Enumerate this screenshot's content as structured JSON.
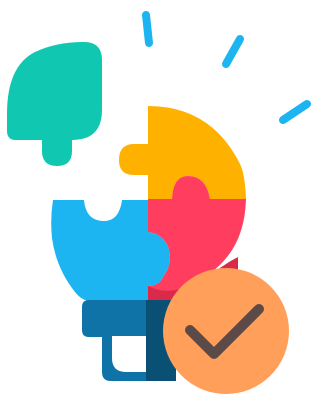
{
  "illustration": {
    "name": "lightbulb-puzzle-success",
    "icon": "lightbulb-puzzle-with-check-icon",
    "colors": {
      "teal": "#10C8B2",
      "orange": "#FFB100",
      "red": "#FF3D5F",
      "dark_red": "#DB2A49",
      "blue": "#1DB4F2",
      "dark_blue": "#0D82B2",
      "base_blue": "#0F73A8",
      "base_shadow": "#0A4F74",
      "badge": "#FF9F5A",
      "check": "#5B4A48"
    }
  }
}
